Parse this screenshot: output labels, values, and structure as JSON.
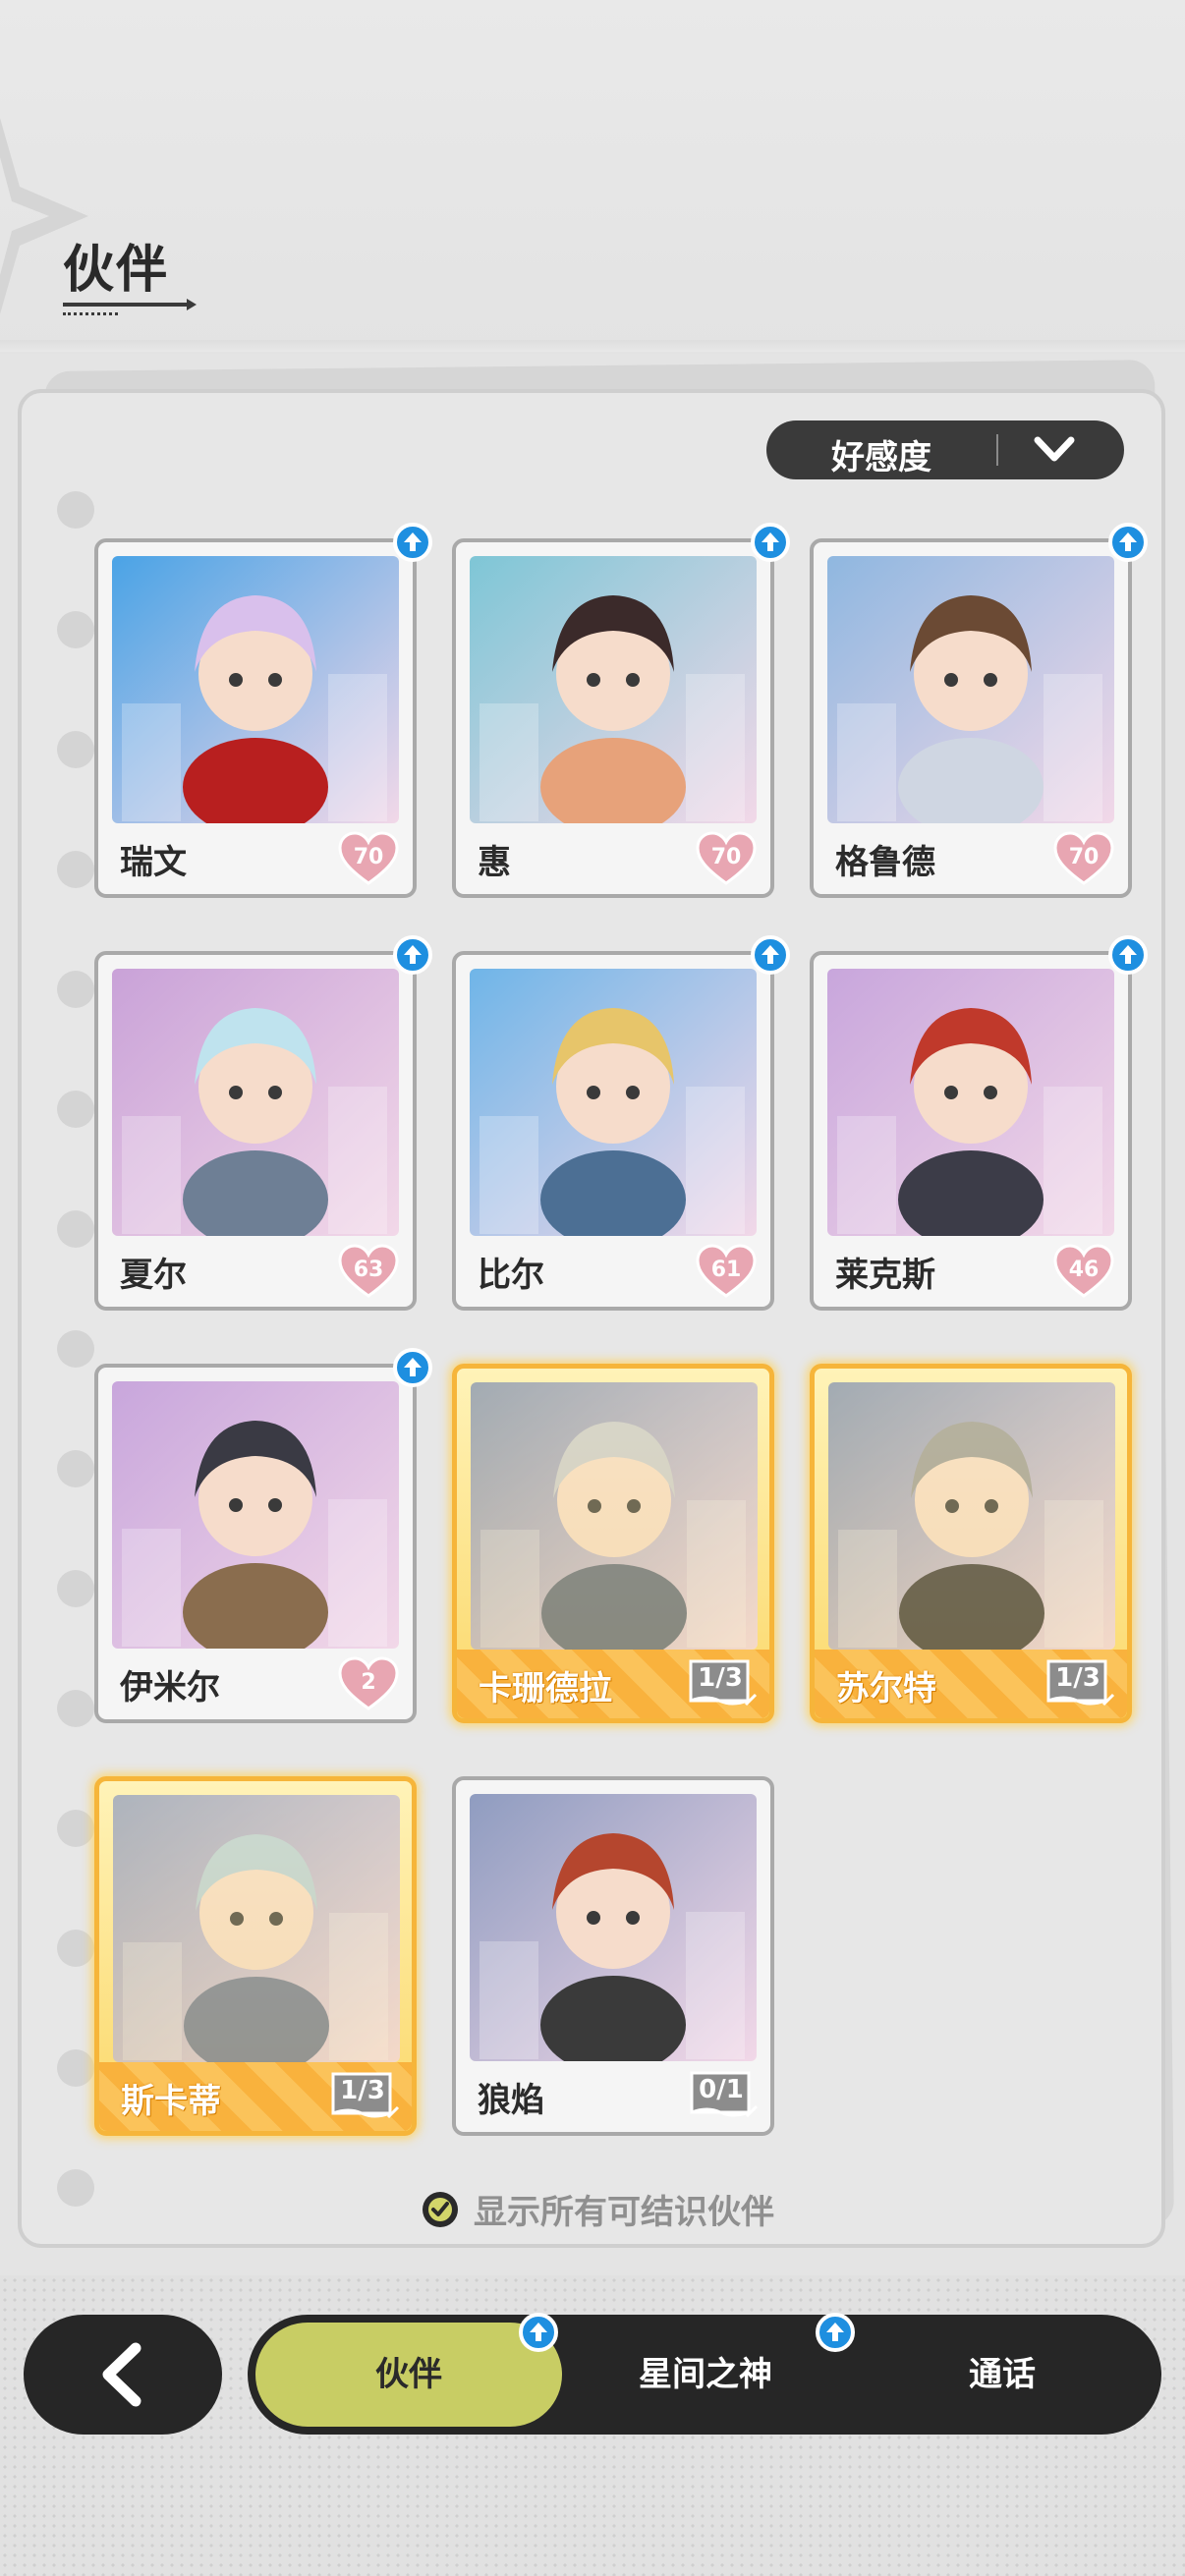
{
  "header": {
    "title": "伙伴"
  },
  "sort": {
    "label": "好感度"
  },
  "partners": [
    {
      "name": "瑞文",
      "affinity": "70",
      "has_upgrade": true,
      "state": "unlocked",
      "colors": [
        "#4aa3e6",
        "#d9c0ec",
        "#b81f1f"
      ]
    },
    {
      "name": "惠",
      "affinity": "70",
      "has_upgrade": true,
      "state": "unlocked",
      "colors": [
        "#7ec6d6",
        "#3b2a2a",
        "#e7a27a"
      ]
    },
    {
      "name": "格鲁德",
      "affinity": "70",
      "has_upgrade": true,
      "state": "unlocked",
      "colors": [
        "#8fb7e0",
        "#6b4a34",
        "#cfd6e2"
      ]
    },
    {
      "name": "夏尔",
      "affinity": "63",
      "has_upgrade": true,
      "state": "unlocked",
      "colors": [
        "#c9a2d8",
        "#bfe3ee",
        "#6e7f95"
      ]
    },
    {
      "name": "比尔",
      "affinity": "61",
      "has_upgrade": true,
      "state": "unlocked",
      "colors": [
        "#6fb5e8",
        "#e7c56a",
        "#4c6f94"
      ]
    },
    {
      "name": "莱克斯",
      "affinity": "46",
      "has_upgrade": true,
      "state": "unlocked",
      "colors": [
        "#c8a6dc",
        "#c0392b",
        "#3c3c48"
      ]
    },
    {
      "name": "伊米尔",
      "affinity": "2",
      "has_upgrade": true,
      "state": "unlocked",
      "colors": [
        "#c8a6dc",
        "#3a3a44",
        "#8a6d4e"
      ]
    },
    {
      "name": "卡珊德拉",
      "progress": "1/3",
      "state": "recruitable",
      "colors": [
        "#7f90b2",
        "#c9ccd3",
        "#5d6a82"
      ]
    },
    {
      "name": "苏尔特",
      "progress": "1/3",
      "state": "recruitable",
      "colors": [
        "#7f90b2",
        "#9a9a9a",
        "#3b3a3e"
      ]
    },
    {
      "name": "斯卡蒂",
      "progress": "1/3",
      "state": "recruitable",
      "colors": [
        "#8f9cc0",
        "#b7d0dc",
        "#6e7a9a"
      ]
    },
    {
      "name": "狼焰",
      "progress": "0/1",
      "state": "locked",
      "colors": [
        "#8f9cc0",
        "#b5462e",
        "#3a3a3a"
      ]
    }
  ],
  "filter": {
    "label": "显示所有可结识伙伴",
    "checked": true
  },
  "nav": {
    "tabs": [
      {
        "label": "伙伴",
        "active": true,
        "has_upgrade": true
      },
      {
        "label": "星间之神",
        "active": false,
        "has_upgrade": true
      },
      {
        "label": "通话",
        "active": false,
        "has_upgrade": false
      }
    ]
  }
}
